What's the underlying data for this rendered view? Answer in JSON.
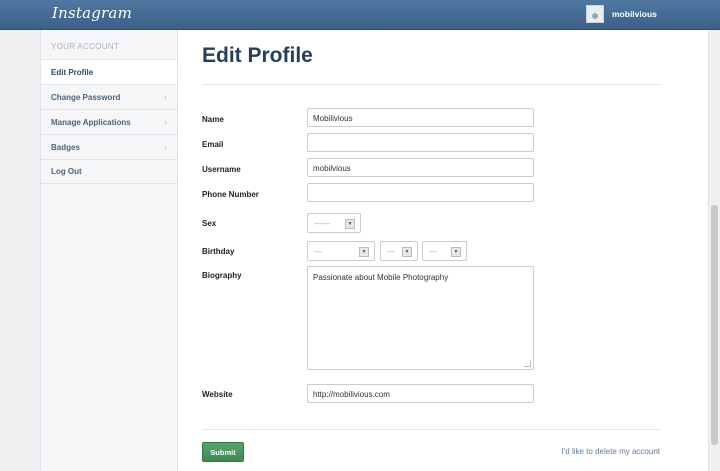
{
  "header": {
    "logo": "Instagram",
    "username": "mobilvious"
  },
  "sidebar": {
    "heading": "YOUR ACCOUNT",
    "items": [
      {
        "label": "Edit Profile",
        "active": true
      },
      {
        "label": "Change Password",
        "active": false
      },
      {
        "label": "Manage Applications",
        "active": false
      },
      {
        "label": "Badges",
        "active": false
      },
      {
        "label": "Log Out",
        "active": false
      }
    ]
  },
  "main": {
    "title": "Edit Profile",
    "labels": {
      "name": "Name",
      "email": "Email",
      "username": "Username",
      "phone": "Phone Number",
      "sex": "Sex",
      "birthday": "Birthday",
      "biography": "Biography",
      "website": "Website"
    },
    "values": {
      "name": "Mobilivious",
      "email": "",
      "username": "mobilvious",
      "phone": "",
      "sex": "——",
      "birthday_month": "—",
      "birthday_day": "—",
      "birthday_year": "—",
      "biography": "Passionate about Mobile Photography",
      "website": "http://mobilivious.com"
    },
    "submit_label": "Submit",
    "delete_link": "I'd like to delete my account"
  }
}
